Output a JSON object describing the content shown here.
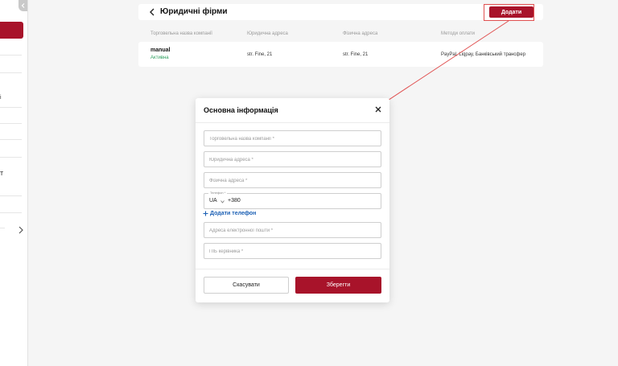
{
  "sidebar": {
    "fragments": [
      "і",
      "т"
    ]
  },
  "header": {
    "title": "Юридичні фірми",
    "add_label": "Додати"
  },
  "table": {
    "columns": [
      "Торговельна назва компанії",
      "Юридична адреса",
      "Фізична адреса",
      "Методи оплати"
    ],
    "rows": [
      {
        "name": "manual",
        "status": "Активна",
        "legal_address": "str. Fine, 21",
        "physical_address": "str. Fine, 21",
        "payment_methods": "PayPal, Liqpay, Банківський трансфер"
      }
    ]
  },
  "modal": {
    "title": "Основна інформація",
    "fields": {
      "trade_name_placeholder": "Торговельна назва компанії *",
      "legal_address_placeholder": "Юридична адреса *",
      "physical_address_placeholder": "Фізична адреса *",
      "phone_label": "Телефон *",
      "phone_country": "UA",
      "phone_code": "+380",
      "email_placeholder": "Адреса електронної пошти *",
      "director_placeholder": "ПІБ керівника *"
    },
    "add_phone_label": "Додати телефон",
    "cancel_label": "Скасувати",
    "save_label": "Зберегти"
  },
  "colors": {
    "accent": "#a8132a",
    "status_active": "#2e9e5e",
    "link": "#1a5fb4",
    "annotation": "#e05050"
  }
}
